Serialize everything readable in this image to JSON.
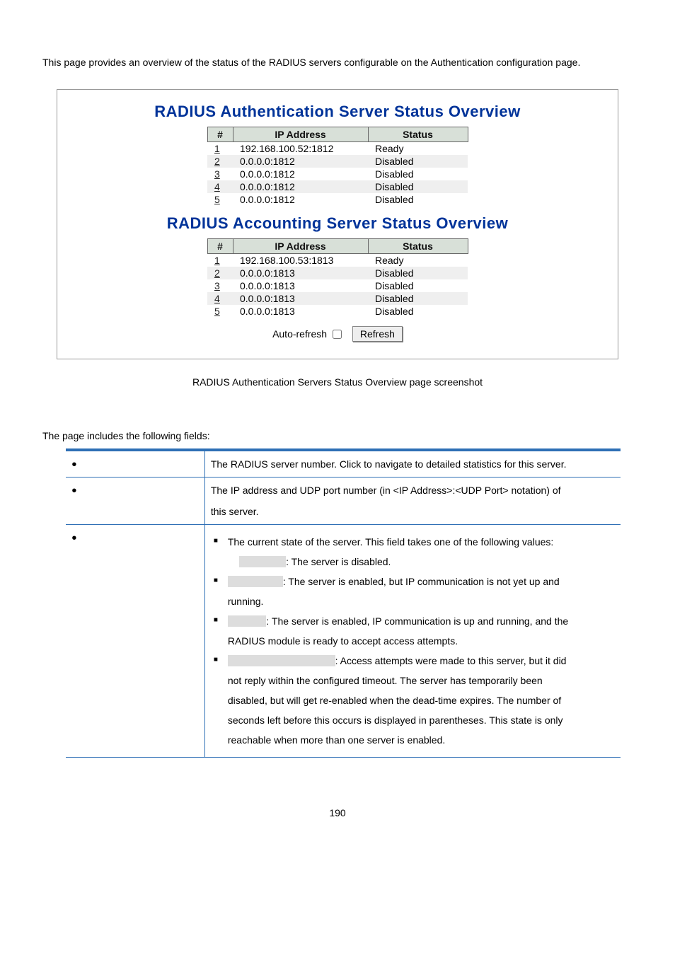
{
  "intro": "This page provides an overview of the status of the RADIUS servers configurable on the Authentication configuration page.",
  "panel": {
    "auth": {
      "title": "RADIUS Authentication Server Status Overview",
      "headers": {
        "num": "#",
        "ip": "IP Address",
        "status": "Status"
      },
      "rows": [
        {
          "num": "1",
          "ip": "192.168.100.52:1812",
          "status": "Ready"
        },
        {
          "num": "2",
          "ip": "0.0.0.0:1812",
          "status": "Disabled"
        },
        {
          "num": "3",
          "ip": "0.0.0.0:1812",
          "status": "Disabled"
        },
        {
          "num": "4",
          "ip": "0.0.0.0:1812",
          "status": "Disabled"
        },
        {
          "num": "5",
          "ip": "0.0.0.0:1812",
          "status": "Disabled"
        }
      ]
    },
    "acct": {
      "title": "RADIUS Accounting Server Status Overview",
      "headers": {
        "num": "#",
        "ip": "IP Address",
        "status": "Status"
      },
      "rows": [
        {
          "num": "1",
          "ip": "192.168.100.53:1813",
          "status": "Ready"
        },
        {
          "num": "2",
          "ip": "0.0.0.0:1813",
          "status": "Disabled"
        },
        {
          "num": "3",
          "ip": "0.0.0.0:1813",
          "status": "Disabled"
        },
        {
          "num": "4",
          "ip": "0.0.0.0:1813",
          "status": "Disabled"
        },
        {
          "num": "5",
          "ip": "0.0.0.0:1813",
          "status": "Disabled"
        }
      ]
    },
    "auto_label": "Auto-refresh",
    "refresh_label": "Refresh"
  },
  "caption": "RADIUS Authentication Servers Status Overview page screenshot",
  "follows": "The page includes the following fields:",
  "fields": {
    "row1_desc": "The RADIUS server number. Click to navigate to detailed statistics for this server.",
    "row2_line1": "The IP address and UDP port number (in <IP Address>:<UDP Port> notation) of",
    "row2_line2": "this server.",
    "row3": {
      "intro": "The current state of the server. This field takes one of the following values:",
      "disabled_after": ": The server is disabled.",
      "notready_after": ": The server is enabled, but IP communication is not yet up and",
      "notready_cont": "running.",
      "ready_after": ": The server is enabled, IP communication is up and running, and the",
      "ready_cont": "RADIUS module is ready to accept access attempts.",
      "dead_after": ": Access attempts were made to this server, but it did",
      "dead_l2": "not reply within the configured timeout. The server has temporarily been",
      "dead_l3": "disabled, but will get re-enabled when the dead-time expires. The number of",
      "dead_l4": "seconds left before this occurs is displayed in parentheses. This state is only",
      "dead_l5": "reachable when more than one server is enabled."
    }
  },
  "pagenum": "190"
}
